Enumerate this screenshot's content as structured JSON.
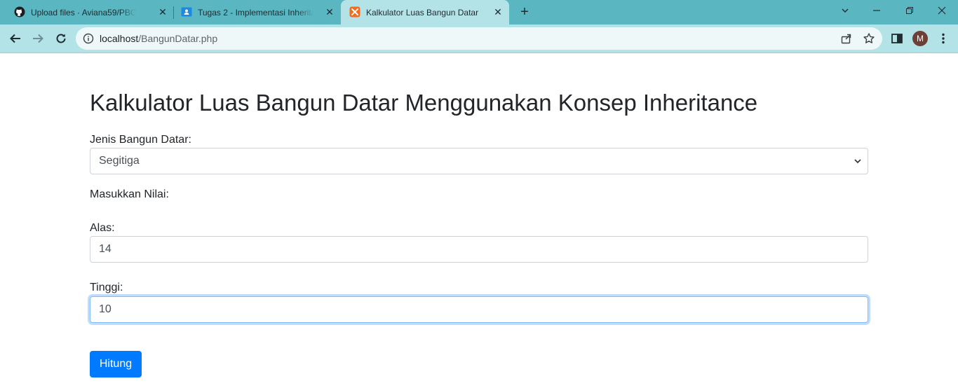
{
  "browser": {
    "tabs": [
      {
        "title": "Upload files · Aviana59/PBO_Tugas",
        "favicon": "github-icon"
      },
      {
        "title": "Tugas 2 - Implementasi Inheritance",
        "favicon": "classroom-icon"
      },
      {
        "title": "Kalkulator Luas Bangun Datar",
        "favicon": "xampp-icon",
        "active": true
      }
    ],
    "address": {
      "host": "localhost",
      "path": "/BangunDatar.php"
    },
    "profile_initial": "M",
    "colors": {
      "tabstrip": "#5ab6c1",
      "toolbar": "#b3e2e7"
    }
  },
  "page": {
    "title": "Kalkulator Luas Bangun Datar Menggunakan Konsep Inheritance",
    "shape_label": "Jenis Bangun Datar:",
    "shape_selected": "Segitiga",
    "values_label": "Masukkan Nilai:",
    "alas_label": "Alas:",
    "alas_value": "14",
    "tinggi_label": "Tinggi:",
    "tinggi_value": "10",
    "submit_label": "Hitung",
    "accent_color": "#007bff"
  }
}
